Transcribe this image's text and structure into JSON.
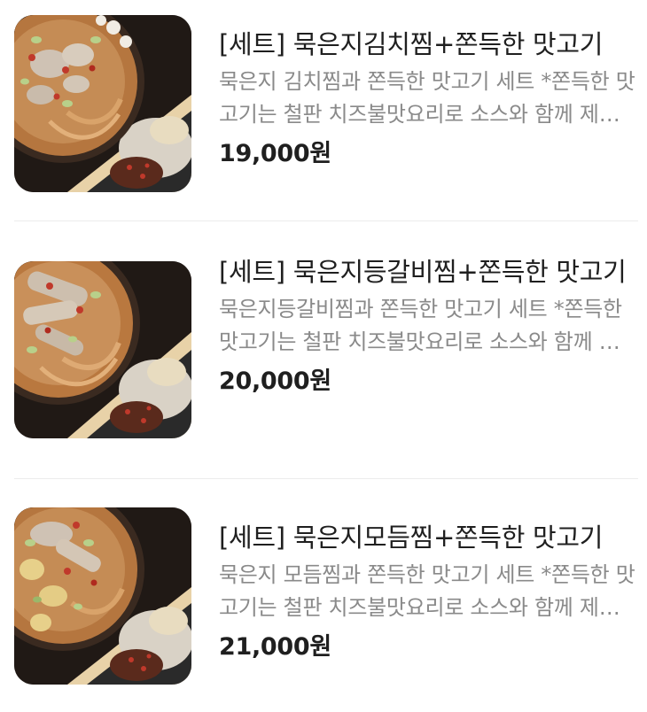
{
  "items": [
    {
      "title": "[세트] 묵은지김치찜+쫀득한 맛고기",
      "description": "묵은지 김치찜과 쫀득한 맛고기 세트 *쫀득한 맛고기는 철판 치즈불맛요리로 소스와 함께 제공됩니다",
      "price": "19,000원",
      "image": "set-kimchi-jjim-photo"
    },
    {
      "title": "[세트] 묵은지등갈비찜+쫀득한 맛고기",
      "description": "묵은지등갈비찜과 쫀득한 맛고기 세트 *쫀득한 맛고기는 철판 치즈불맛요리로 소스와 함께 제공됩니다",
      "price": "20,000원",
      "image": "set-deunggalbi-jjim-photo"
    },
    {
      "title": "[세트] 묵은지모듬찜+쫀득한 맛고기",
      "description": "묵은지 모듬찜과 쫀득한 맛고기 세트 *쫀득한 맛고기는 철판 치즈불맛요리로 소스와 함께 제공됩니다",
      "price": "21,000원",
      "image": "set-modeum-jjim-photo"
    }
  ],
  "colors": {
    "title": "#1f1f1f",
    "description": "#8a8a8a",
    "price": "#1f1f1f",
    "divider": "#ececec"
  }
}
